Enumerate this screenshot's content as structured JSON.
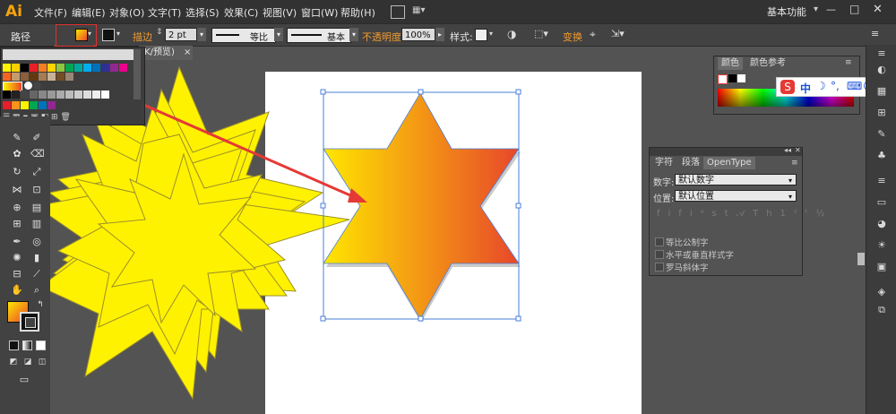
{
  "app": {
    "logo": "Ai",
    "workspace": "基本功能"
  },
  "menu": [
    "文件(F)",
    "编辑(E)",
    "对象(O)",
    "文字(T)",
    "选择(S)",
    "效果(C)",
    "视图(V)",
    "窗口(W)",
    "帮助(H)"
  ],
  "control_bar": {
    "selection_label": "路径",
    "stroke_label": "描边",
    "stroke_weight": "2 pt",
    "profile_label": "等比",
    "brush_label": "基本",
    "opacity_label": "不透明度",
    "opacity_value": "100%",
    "style_label": "样式:",
    "transform_label": "变换"
  },
  "document_tab": {
    "label": "YK/预览)",
    "close": "×"
  },
  "color_panel": {
    "tabs": [
      "颜色",
      "颜色参考"
    ]
  },
  "opentype_panel": {
    "tabs": [
      "字符",
      "段落",
      "OpenType"
    ],
    "number_label": "数字:",
    "number_value": "默认数字",
    "position_label": "位置:",
    "position_value": "默认位置",
    "options": [
      "等比公制字",
      "水平或垂直样式字",
      "罗马斜体字"
    ]
  },
  "ime": {
    "mode": "中"
  },
  "colors": {
    "accent_orange": "#f29a2e",
    "star_yellow": "#fff200",
    "gradient_start": "#ffe600",
    "gradient_end": "#e8472a",
    "arrow_red": "#e53935",
    "selection_blue": "#4a7fd8"
  }
}
